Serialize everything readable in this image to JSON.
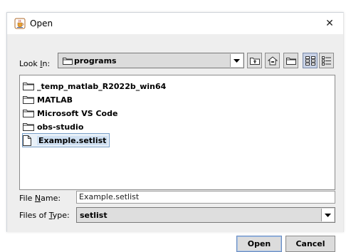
{
  "window": {
    "title": "Open",
    "close_glyph": "✕",
    "icon": "java-cup-icon"
  },
  "look_in": {
    "label_prefix": "Look ",
    "label_mnemonic": "I",
    "label_suffix": "n:",
    "value": "programs"
  },
  "toolbar": {
    "buttons": [
      "up-one-level-icon",
      "home-icon",
      "new-folder-icon",
      "list-view-icon",
      "details-view-icon"
    ],
    "selected": "list-view-icon"
  },
  "files": [
    {
      "name": "_temp_matlab_R2022b_win64",
      "type": "folder"
    },
    {
      "name": "MATLAB",
      "type": "folder"
    },
    {
      "name": "Microsoft VS Code",
      "type": "folder"
    },
    {
      "name": "obs-studio",
      "type": "folder"
    },
    {
      "name": "Example.setlist",
      "type": "file",
      "selected": true
    }
  ],
  "file_name": {
    "label_prefix": "File ",
    "label_mnemonic": "N",
    "label_suffix": "ame:",
    "value": "Example.setlist"
  },
  "file_type": {
    "label_prefix": "Files of ",
    "label_mnemonic": "T",
    "label_suffix": "ype:",
    "value": "setlist"
  },
  "buttons": {
    "open": "Open",
    "cancel": "Cancel"
  }
}
